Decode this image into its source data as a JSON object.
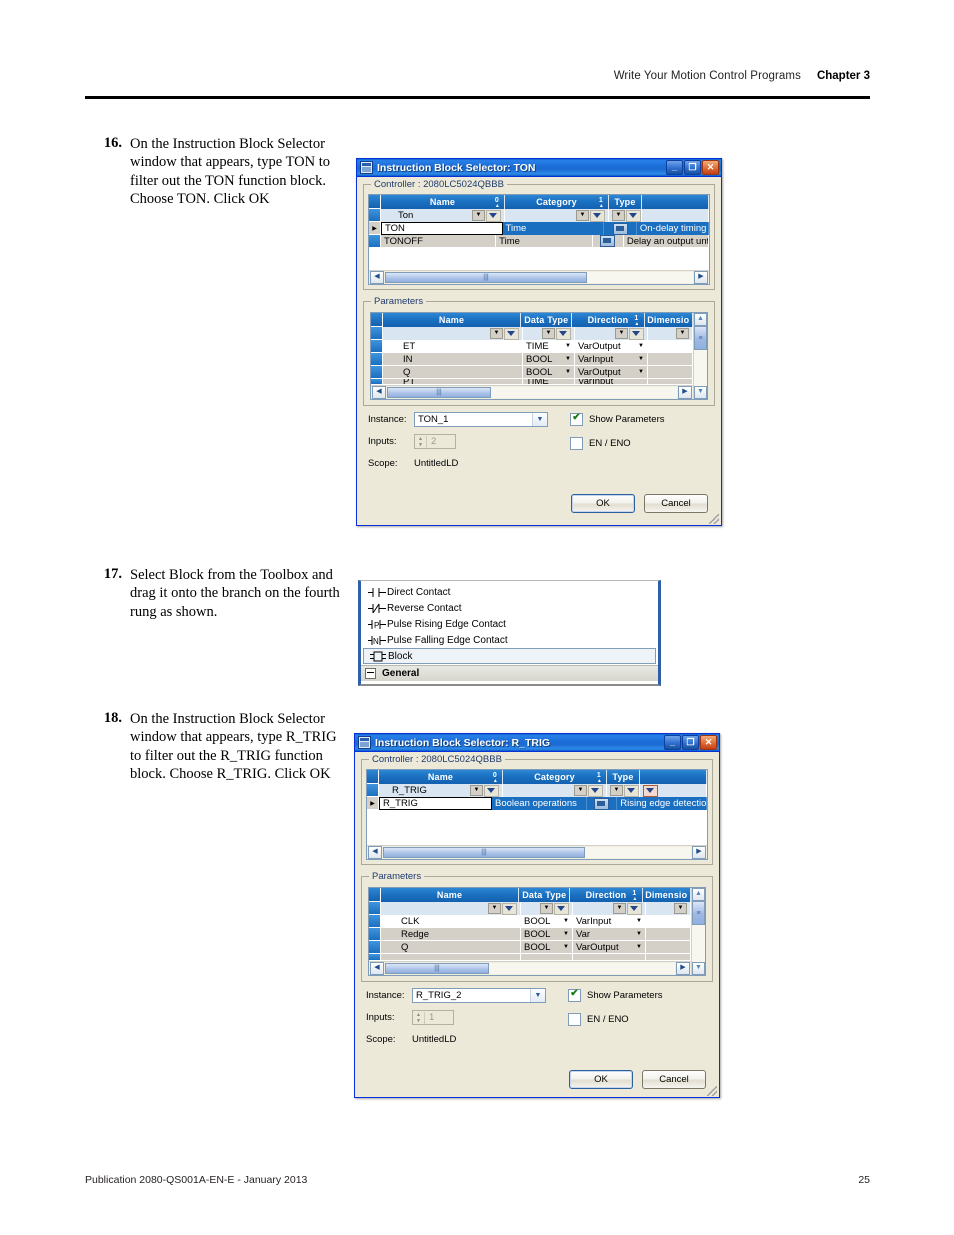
{
  "header": {
    "title": "Write Your Motion Control Programs",
    "chapter": "Chapter 3"
  },
  "footer": {
    "publication": "Publication 2080-QS001A-EN-E - January 2013",
    "page": "25"
  },
  "steps": [
    {
      "number": "16.",
      "text": "On the Instruction Block Selector window that appears, type TON to filter out the TON function block. Choose TON. Click OK"
    },
    {
      "number": "17.",
      "text": "Select Block from the Toolbox and drag it onto the branch on the fourth rung as shown."
    },
    {
      "number": "18.",
      "text": "On the Instruction Block Selector window that appears, type R_TRIG to filter out the R_TRIG function block. Choose R_TRIG. Click OK"
    }
  ],
  "dialog_ton": {
    "title": "Instruction Block Selector: TON",
    "minimize_glyph": "_",
    "maximize_glyph": "❐",
    "close_glyph": "✕",
    "controller_label": "Controller : 2080LC5024QBBB",
    "results": {
      "columns": [
        "Name",
        "Category",
        "Type",
        ""
      ],
      "sort_markers": [
        "0",
        "1",
        "",
        ""
      ],
      "filter_values": [
        "Ton",
        "",
        "",
        ""
      ],
      "rows": [
        {
          "name": "TON",
          "category": "Time",
          "type": "fb-icon",
          "description": "On-delay timing",
          "selected": true
        },
        {
          "name": "TONOFF",
          "category": "Time",
          "type": "fb-icon",
          "description": "Delay an output unti",
          "selected": false
        }
      ]
    },
    "parameters": {
      "group_label": "Parameters",
      "columns": [
        "Name",
        "Data Type",
        "Direction",
        "Dimensio"
      ],
      "sort_markers": [
        "",
        "",
        "1",
        ""
      ],
      "rows": [
        {
          "name": "ET",
          "data_type": "TIME",
          "direction": "VarOutput",
          "dimension": ""
        },
        {
          "name": "IN",
          "data_type": "BOOL",
          "direction": "VarInput",
          "dimension": ""
        },
        {
          "name": "Q",
          "data_type": "BOOL",
          "direction": "VarOutput",
          "dimension": ""
        },
        {
          "name": "PT",
          "data_type": "TIME",
          "direction": "VarInput",
          "dimension": ""
        }
      ]
    },
    "form": {
      "instance_label": "Instance:",
      "instance_value": "TON_1",
      "inputs_label": "Inputs:",
      "inputs_value": "2",
      "scope_label": "Scope:",
      "scope_value": "UntitledLD",
      "show_parameters_label": "Show Parameters",
      "show_parameters_checked": true,
      "en_eno_label": "EN / ENO",
      "en_eno_checked": false,
      "ok_label": "OK",
      "cancel_label": "Cancel"
    }
  },
  "toolbox": {
    "items": [
      {
        "label": "Direct Contact",
        "icon": "direct-contact-icon",
        "selected": false
      },
      {
        "label": "Reverse Contact",
        "icon": "reverse-contact-icon",
        "selected": false
      },
      {
        "label": "Pulse Rising Edge Contact",
        "icon": "pulse-rising-edge-contact-icon",
        "selected": false
      },
      {
        "label": "Pulse Falling Edge Contact",
        "icon": "pulse-falling-edge-contact-icon",
        "selected": false
      },
      {
        "label": "Block",
        "icon": "block-icon",
        "selected": true
      }
    ],
    "group_label": "General"
  },
  "dialog_rtrig": {
    "title": "Instruction Block Selector: R_TRIG",
    "minimize_glyph": "_",
    "maximize_glyph": "❐",
    "close_glyph": "✕",
    "controller_label": "Controller : 2080LC5024QBBB",
    "results": {
      "columns": [
        "Name",
        "Category",
        "Type",
        ""
      ],
      "sort_markers": [
        "0",
        "1",
        "",
        ""
      ],
      "filter_values": [
        "R_TRIG",
        "",
        "",
        ""
      ],
      "rows": [
        {
          "name": "R_TRIG",
          "category": "Boolean operations",
          "type": "fb-icon",
          "description": "Rising edge detection",
          "selected": true
        }
      ]
    },
    "parameters": {
      "group_label": "Parameters",
      "columns": [
        "Name",
        "Data Type",
        "Direction",
        "Dimensio"
      ],
      "sort_markers": [
        "",
        "",
        "1",
        ""
      ],
      "rows": [
        {
          "name": "CLK",
          "data_type": "BOOL",
          "direction": "VarInput",
          "dimension": ""
        },
        {
          "name": "Redge",
          "data_type": "BOOL",
          "direction": "Var",
          "dimension": ""
        },
        {
          "name": "Q",
          "data_type": "BOOL",
          "direction": "VarOutput",
          "dimension": ""
        }
      ]
    },
    "form": {
      "instance_label": "Instance:",
      "instance_value": "R_TRIG_2",
      "inputs_label": "Inputs:",
      "inputs_value": "1",
      "scope_label": "Scope:",
      "scope_value": "UntitledLD",
      "show_parameters_label": "Show Parameters",
      "show_parameters_checked": true,
      "en_eno_label": "EN / ENO",
      "en_eno_checked": false,
      "ok_label": "OK",
      "cancel_label": "Cancel"
    }
  },
  "colors": {
    "title_bar_blue": "#1b6ad3",
    "grid_header_blue": "#1a6fc0",
    "selection_blue": "#1a6fc0",
    "dialog_face": "#ece9d8",
    "toolbox_border": "#2f5fa8"
  }
}
